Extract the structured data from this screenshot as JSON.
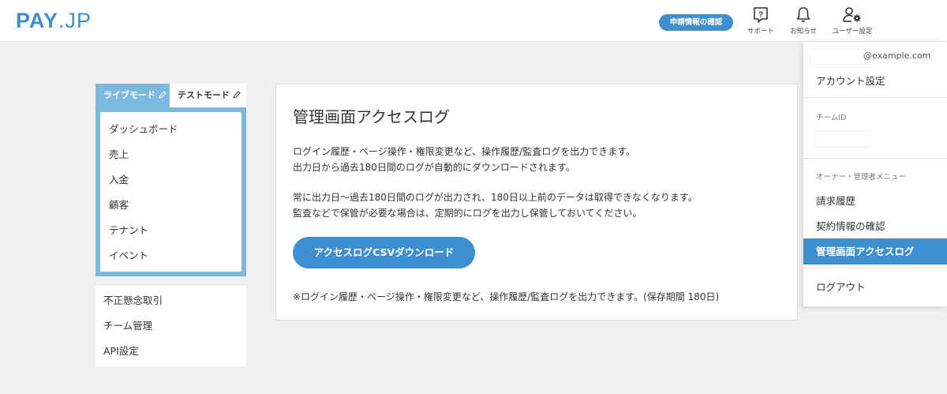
{
  "header": {
    "logo_main": "PAY",
    "logo_suffix": ".JP",
    "apply_label": "申請情報の確認",
    "icons": [
      {
        "name": "support",
        "label": "サポート"
      },
      {
        "name": "notifications",
        "label": "お知らせ"
      },
      {
        "name": "user-settings",
        "label": "ユーザー設定"
      }
    ]
  },
  "modes": {
    "live": "ライブモード",
    "test": "テストモード"
  },
  "sidebar": {
    "main_items": [
      {
        "label": "ダッシュボード"
      },
      {
        "label": "売上"
      },
      {
        "label": "入金"
      },
      {
        "label": "顧客"
      },
      {
        "label": "テナント"
      },
      {
        "label": "イベント"
      }
    ],
    "extra_items": [
      {
        "label": "不正懸念取引"
      },
      {
        "label": "チーム管理"
      },
      {
        "label": "API設定"
      }
    ]
  },
  "main": {
    "title": "管理画面アクセスログ",
    "para1_line1": "ログイン履歴・ページ操作・権限変更など、操作履歴/監査ログを出力できます。",
    "para1_line2": "出力日から過去180日間のログが自動的にダウンロードされます。",
    "para2_line1": "常に出力日〜過去180日間のログが出力され、180日以上前のデータは取得できなくなります。",
    "para2_line2": "監査などで保管が必要な場合は、定期的にログを出力し保管しておいてください。",
    "download_label": "アクセスログCSVダウンロード",
    "note": "※ログイン履歴・ページ操作・権限変更など、操作履歴/監査ログを出力できます。(保存期間 180日)"
  },
  "user_menu": {
    "email": "@example.com",
    "account_settings": "アカウント設定",
    "team_id_label": "チームID",
    "owner_menu_label": "オーナー・管理者メニュー",
    "billing_history": "請求履歴",
    "contract_info": "契約情報の確認",
    "access_log": "管理画面アクセスログ",
    "logout": "ログアウト"
  },
  "colors": {
    "brand_blue": "#3d8fd0",
    "sidebar_blue": "#7db9de",
    "background": "#f0f0f0"
  }
}
